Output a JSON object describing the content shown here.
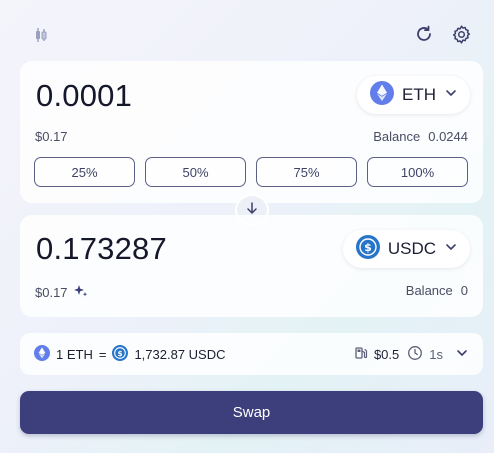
{
  "from": {
    "amount": "0.0001",
    "usd_value": "$0.17",
    "token": {
      "symbol": "ETH",
      "icon": "eth-icon"
    },
    "balance_label": "Balance",
    "balance_value": "0.0244",
    "percent_options": [
      "25%",
      "50%",
      "75%",
      "100%"
    ]
  },
  "to": {
    "amount": "0.173287",
    "usd_value": "$0.17",
    "token": {
      "symbol": "USDC",
      "icon": "usdc-icon"
    },
    "balance_label": "Balance",
    "balance_value": "0"
  },
  "rate": {
    "from_amount": "1 ETH",
    "equals": "=",
    "to_amount": "1,732.87 USDC",
    "gas_fee": "$0.5",
    "time": "1s"
  },
  "swap_button_label": "Swap",
  "colors": {
    "primary_button": "#3d3f7c",
    "eth": "#627eea",
    "usdc": "#2775ca",
    "pct_border": "#5c5f86"
  }
}
